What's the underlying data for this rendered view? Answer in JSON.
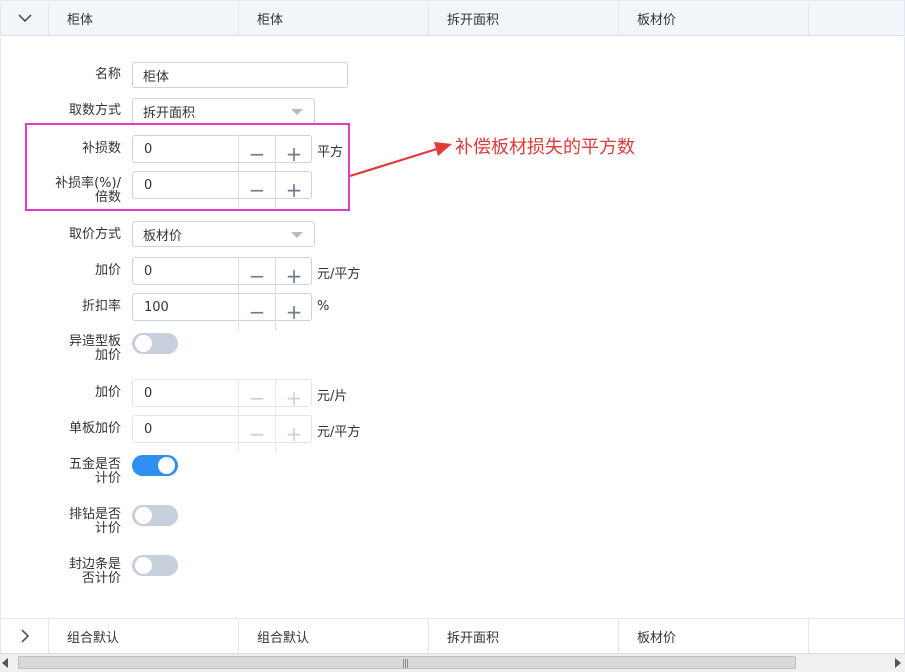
{
  "header": {
    "toggle_icon": "chevron-down-icon",
    "cells": [
      "柜体",
      "柜体",
      "拆开面积",
      "板材价"
    ]
  },
  "form": {
    "name": {
      "label": "名称",
      "value": "柜体"
    },
    "calc_method": {
      "label": "取数方式",
      "value": "拆开面积"
    },
    "loss_amount": {
      "label": "补损数",
      "value": "0",
      "unit": "平方"
    },
    "loss_rate": {
      "label_line1": "补损率(%)/",
      "label_line2": "倍数",
      "value": "0"
    },
    "price_method": {
      "label": "取价方式",
      "value": "板材价"
    },
    "markup": {
      "label": "加价",
      "value": "0",
      "unit": "元/平方"
    },
    "discount": {
      "label": "折扣率",
      "value": "100",
      "unit": "%"
    },
    "special_panel": {
      "label_line1": "异造型板",
      "label_line2": "加价",
      "on": false
    },
    "piece_markup": {
      "label": "加价",
      "value": "0",
      "unit": "元/片"
    },
    "single_panel_markup": {
      "label": "单板加价",
      "value": "0",
      "unit": "元/平方"
    },
    "hardware": {
      "label_line1": "五金是否",
      "label_line2": "计价",
      "on": true
    },
    "drilling": {
      "label_line1": "排钻是否",
      "label_line2": "计价",
      "on": false
    },
    "edge_banding": {
      "label_line1": "封边条是",
      "label_line2": "否计价",
      "on": false
    }
  },
  "annotation": {
    "text": "补偿板材损失的平方数",
    "color": "#e03a3a",
    "box_color": "#e23ccf"
  },
  "footer": {
    "toggle_icon": "chevron-right-icon",
    "cells": [
      "组合默认",
      "组合默认",
      "拆开面积",
      "板材价"
    ]
  },
  "stepper_icons": {
    "minus": "minus-icon",
    "plus": "plus-icon"
  },
  "colors": {
    "toggle_on": "#2f8ff0",
    "toggle_off": "#c6cfdb",
    "header_bg": "#f2f6fb"
  }
}
